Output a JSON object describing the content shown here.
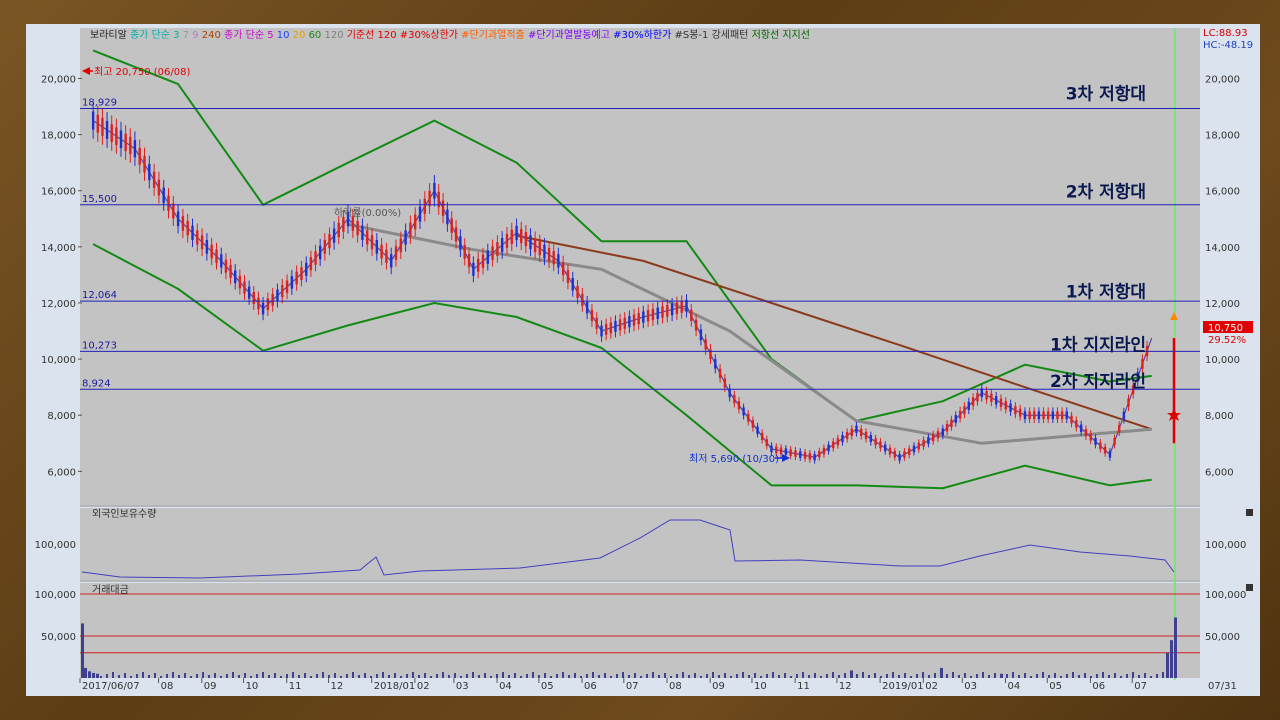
{
  "legend": [
    {
      "text": "보라티알",
      "color": "#222222"
    },
    {
      "text": "종가 단순 3",
      "color": "#00b0b0"
    },
    {
      "text": "7",
      "color": "#9a9a9a"
    },
    {
      "text": "9",
      "color": "#b07fd0"
    },
    {
      "text": "240",
      "color": "#aa4400"
    },
    {
      "text": "종가 단순 5",
      "color": "#d000d0"
    },
    {
      "text": "10",
      "color": "#2040ff"
    },
    {
      "text": "20",
      "color": "#e0a000"
    },
    {
      "text": "60",
      "color": "#208020"
    },
    {
      "text": "120",
      "color": "#808080"
    },
    {
      "text": "기준선 120",
      "color": "#e00000"
    },
    {
      "text": "#30%상한가",
      "color": "#e00000"
    },
    {
      "text": "#단기과열적출",
      "color": "#ff6000"
    },
    {
      "text": "#단기과열발동예고",
      "color": "#8000ff"
    },
    {
      "text": "#30%하한가",
      "color": "#0000ff"
    },
    {
      "text": "#S봉-1 강세패턴",
      "color": "#333333"
    },
    {
      "text": "저항선",
      "color": "#006000"
    },
    {
      "text": "지지선",
      "color": "#006000"
    }
  ],
  "lc_label": "LC:88.93",
  "hc_label": "HC:-48.19",
  "price_axis_ticks": [
    "20,000",
    "18,000",
    "16,000",
    "14,000",
    "12,000",
    "10,000",
    "8,000",
    "6,000"
  ],
  "volume_axis_ticks": [
    "100,000",
    "50,000"
  ],
  "foreign_axis_tick": "100,000",
  "x_ticks": [
    "2017/06/07",
    "08",
    "09",
    "10",
    "11",
    "12",
    "2018/01",
    "02",
    "03",
    "04",
    "05",
    "06",
    "07",
    "08",
    "09",
    "10",
    "11",
    "12",
    "2019/01",
    "02",
    "03",
    "04",
    "05",
    "06",
    "07"
  ],
  "x_tick_right": "07/31",
  "annotations": {
    "high": "최고 20,750 (06/08)",
    "low": "최저 5,690 (10/30)",
    "fall_rate": "하락률(0.00%)",
    "current_price": "10,750",
    "current_change": "29.52%"
  },
  "level_labels": [
    {
      "value": 18929,
      "text": "18,929"
    },
    {
      "value": 15500,
      "text": "15,500"
    },
    {
      "value": 12064,
      "text": "12,064"
    },
    {
      "value": 10273,
      "text": "10,273"
    },
    {
      "value": 8924,
      "text": "8,924"
    }
  ],
  "zone_labels": [
    {
      "value": 19500,
      "text": "3차 저항대"
    },
    {
      "value": 16000,
      "text": "2차 저항대"
    },
    {
      "value": 12450,
      "text": "1차 저항대"
    },
    {
      "value": 10550,
      "text": "1차 지지라인"
    },
    {
      "value": 9250,
      "text": "2차 지지라인"
    }
  ],
  "sub_panels": {
    "foreign": "외국인보유수량",
    "volume": "거래대금"
  },
  "chart_data": {
    "type": "line",
    "title": "보라티알",
    "x_range": [
      "2017-06-07",
      "2019-07-31"
    ],
    "ylim": [
      4800,
      21800
    ],
    "price_series": {
      "name": "보라티알",
      "x": [
        "2017-06",
        "2017-07",
        "2017-08",
        "2017-09",
        "2017-10",
        "2017-11",
        "2017-12",
        "2018-01",
        "2018-02",
        "2018-03",
        "2018-04",
        "2018-05",
        "2018-06",
        "2018-07",
        "2018-08",
        "2018-09",
        "2018-10",
        "2018-11",
        "2018-12",
        "2019-01",
        "2019-02",
        "2019-03",
        "2019-04",
        "2019-05",
        "2019-06",
        "2019-07"
      ],
      "values": [
        18500,
        17500,
        15000,
        13500,
        11800,
        13200,
        15000,
        13500,
        16000,
        13200,
        14500,
        13500,
        11000,
        11500,
        11900,
        8800,
        6800,
        6500,
        7500,
        6500,
        7400,
        8800,
        8000,
        8000,
        6600,
        10750
      ]
    },
    "moving_average_240": {
      "x": [
        "2018-04",
        "2018-07",
        "2018-10",
        "2019-01",
        "2019-04",
        "2019-07"
      ],
      "values": [
        14400,
        13500,
        12000,
        10500,
        9000,
        7500
      ]
    },
    "moving_average_120": {
      "x": [
        "2017-12",
        "2018-03",
        "2018-06",
        "2018-09",
        "2018-12",
        "2019-03",
        "2019-07"
      ],
      "values": [
        14800,
        13900,
        13200,
        11000,
        7800,
        7000,
        7500
      ]
    },
    "bollinger_upper": {
      "x": [
        "2017-06",
        "2017-08",
        "2017-10",
        "2017-12",
        "2018-02",
        "2018-04",
        "2018-06",
        "2018-08",
        "2018-10",
        "2018-12",
        "2019-02",
        "2019-04",
        "2019-06",
        "2019-07"
      ],
      "values": [
        21000,
        19800,
        15500,
        17000,
        18500,
        17000,
        14200,
        14200,
        10000,
        7800,
        8500,
        9800,
        9200,
        9400
      ]
    },
    "bollinger_lower": {
      "x": [
        "2017-06",
        "2017-08",
        "2017-10",
        "2017-12",
        "2018-02",
        "2018-04",
        "2018-06",
        "2018-08",
        "2018-10",
        "2018-12",
        "2019-02",
        "2019-04",
        "2019-06",
        "2019-07"
      ],
      "values": [
        14100,
        12500,
        10300,
        11200,
        12000,
        11500,
        10400,
        8000,
        5500,
        5500,
        5400,
        6200,
        5500,
        5700
      ]
    },
    "horizontal_levels": [
      18929,
      15500,
      12064,
      10273,
      8924
    ],
    "high": {
      "value": 20750,
      "date": "06/08"
    },
    "low": {
      "value": 5690,
      "date": "10/30"
    },
    "volume_ylim": [
      0,
      100000
    ],
    "volume_reference_lines": [
      100000,
      50000,
      30000
    ]
  }
}
